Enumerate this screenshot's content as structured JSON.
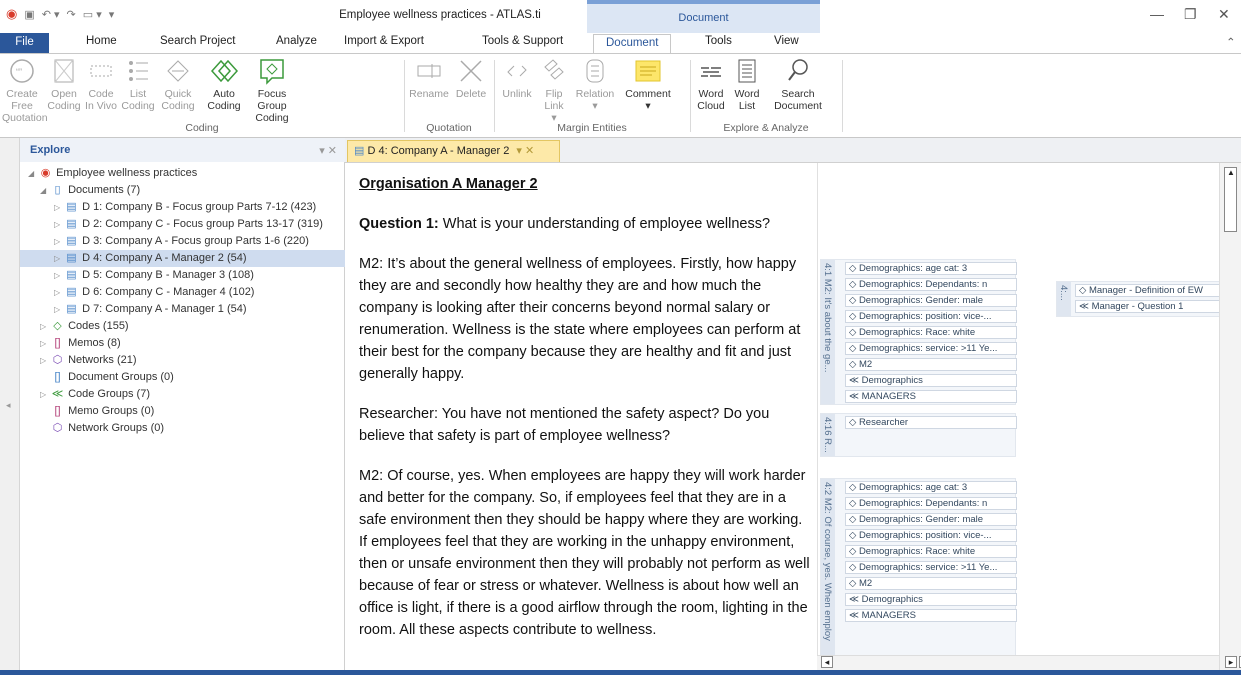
{
  "window": {
    "title": "Employee wellness practices - ATLAS.ti",
    "context_tab_group": "Document"
  },
  "tabs": [
    "File",
    "Home",
    "Search Project",
    "Analyze",
    "Import & Export",
    "Tools & Support",
    "Document",
    "Tools",
    "View"
  ],
  "ribbon": {
    "buttons": [
      "Create Free Quotation",
      "Open Coding",
      "Code In Vivo",
      "List Coding",
      "Quick Coding",
      "Auto Coding",
      "Focus Group Coding",
      "Rename",
      "Delete",
      "Unlink",
      "Flip Link",
      "Relation",
      "Comment",
      "Word Cloud",
      "Word List",
      "Search Document"
    ],
    "groups": [
      "Coding",
      "Quotation",
      "Margin Entities",
      "Explore & Analyze"
    ]
  },
  "explore": {
    "header": "Explore",
    "project": "Employee wellness practices",
    "documents_label": "Documents (7)",
    "documents": [
      "D 1: Company B - Focus group Parts 7-12 (423)",
      "D 2: Company C - Focus group Parts 13-17 (319)",
      "D 3: Company A - Focus group Parts 1-6 (220)",
      "D 4: Company A - Manager 2 (54)",
      "D 5: Company B - Manager 3 (108)",
      "D 6: Company C - Manager 4 (102)",
      "D 7: Company A - Manager 1 (54)"
    ],
    "others": [
      "Codes (155)",
      "Memos (8)",
      "Networks (21)",
      "Document Groups (0)",
      "Code Groups (7)",
      "Memo Groups (0)",
      "Network Groups (0)"
    ]
  },
  "document": {
    "tab_label": "D 4: Company A - Manager 2",
    "heading": "Organisation A Manager 2",
    "q_label": "Question 1:",
    "q_text": " What is your understanding of employee wellness?",
    "p1": "M2: It’s about the general wellness of employees. Firstly, how happy they are and secondly how healthy they are and how much the company is looking after their concerns beyond normal salary or renumeration. Wellness is the state where employees can perform at their best for the company because they are healthy and fit and just generally happy.",
    "p2": "Researcher: You have not mentioned the safety aspect? Do you believe that safety is part of employee wellness?",
    "p3": "M2: Of course, yes. When employees are happy they will work harder and better for the company. So, if employees feel that they are in a safe environment then they should be happy where they are working. If employees feel that they are working in the unhappy environment, then or unsafe environment then they will probably not perform as well because of fear or stress or whatever. Wellness is about how well an office is light, if there is a good airflow through the room, lighting in the room. All these aspects contribute to wellness."
  },
  "margin": {
    "g1_label": "4:1 M2: It's about the ge...",
    "g2_label": "4:16 R...",
    "g3_label": "4:2 M2: Of course, yes. When employ",
    "g4_label": "4:...",
    "codes_a": [
      "◇ Demographics: age cat: 3",
      "◇ Demographics: Dependants: n",
      "◇ Demographics: Gender: male",
      "◇ Demographics: position: vice-...",
      "◇ Demographics: Race: white",
      "◇ Demographics: service: >11 Ye...",
      "◇ M2",
      "≪ Demographics",
      "≪ MANAGERS"
    ],
    "code_researcher": "◇ Researcher",
    "codes_right": [
      "◇ Manager - Definition of EW",
      "≪ Manager - Question 1"
    ]
  }
}
